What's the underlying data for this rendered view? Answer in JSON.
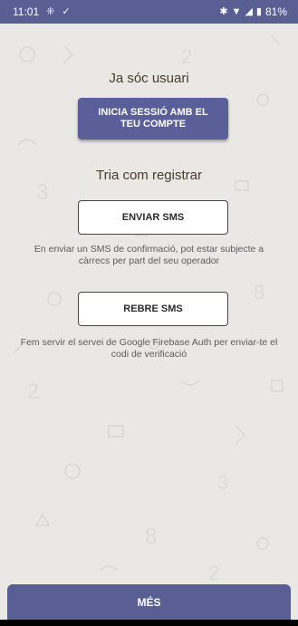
{
  "status_bar": {
    "time": "11:01",
    "left_icons": [
      "grid-icon",
      "download-done-icon"
    ],
    "right_icons": [
      "bluetooth-icon",
      "wifi-icon",
      "signal-icon",
      "battery-icon"
    ],
    "battery": "81%"
  },
  "login": {
    "heading": "Ja sóc usuari",
    "button_label": "INICIA SESSIÓ AMB EL TEU COMPTE"
  },
  "register": {
    "heading": "Tria com registrar",
    "send_sms_label": "ENVIAR SMS",
    "send_sms_note": "En enviar un SMS de confirmació, pot estar subjecte a càrrecs per part del seu operador",
    "receive_sms_label": "REBRE SMS",
    "receive_sms_note": "Fem servir el servei de Google Firebase Auth per enviar-te el codi de verificació"
  },
  "footer": {
    "more_label": "MÉS"
  },
  "colors": {
    "accent": "#5a5f93",
    "background": "#e9e8e4"
  }
}
